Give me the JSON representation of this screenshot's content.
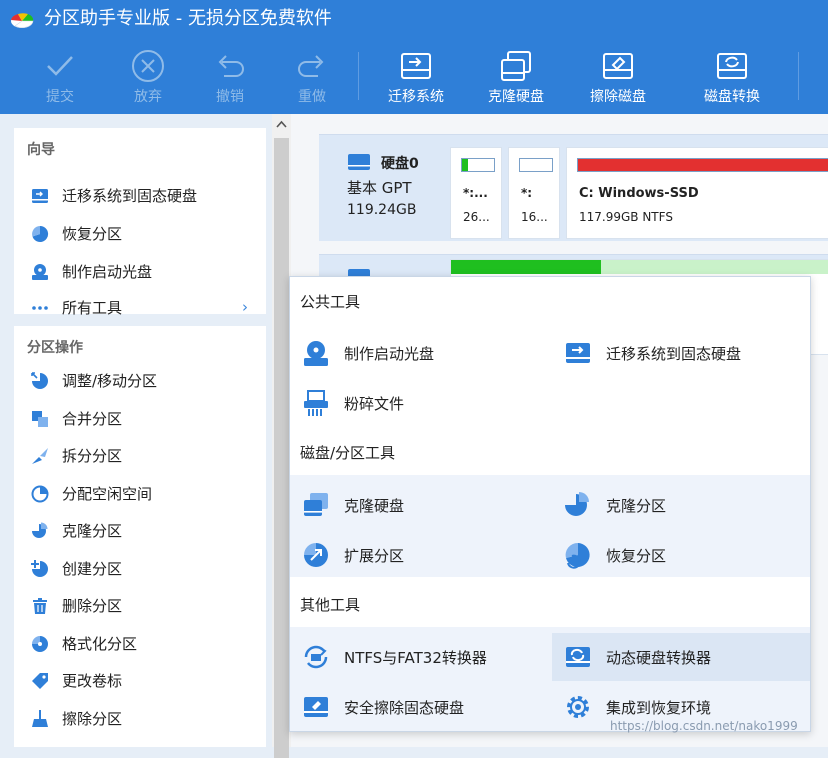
{
  "window": {
    "title": "分区助手专业版 - 无损分区免费软件"
  },
  "toolbar": {
    "submit": "提交",
    "discard": "放弃",
    "undo": "撤销",
    "redo": "重做",
    "migrate": "迁移系统",
    "clone_disk": "克隆硬盘",
    "wipe_disk": "擦除磁盘",
    "convert_disk": "磁盘转换"
  },
  "wizard": {
    "header": "向导",
    "items": [
      "迁移系统到固态硬盘",
      "恢复分区",
      "制作启动光盘",
      "所有工具"
    ]
  },
  "operations": {
    "header": "分区操作",
    "items": [
      "调整/移动分区",
      "合并分区",
      "拆分分区",
      "分配空闲空间",
      "克隆分区",
      "创建分区",
      "删除分区",
      "格式化分区",
      "更改卷标",
      "擦除分区"
    ]
  },
  "disks": [
    {
      "name": "硬盘0",
      "style": "基本 GPT",
      "size": "119.24GB",
      "partitions": [
        {
          "label": "*:...",
          "size": "26...",
          "fill_percent": 20,
          "fill_color": "#1fbf1f"
        },
        {
          "label": "*:",
          "size": "16...",
          "fill_percent": 0,
          "fill_color": "#1fbf1f"
        },
        {
          "label": "C: Windows-SSD",
          "size": "117.99GB NTFS",
          "fill_percent": 100,
          "fill_color": "#e33030"
        }
      ]
    }
  ],
  "popup": {
    "sections": [
      {
        "title": "公共工具",
        "tools": [
          "制作启动光盘",
          "迁移系统到固态硬盘",
          "粉碎文件"
        ]
      },
      {
        "title": "磁盘/分区工具",
        "tools": [
          "克隆硬盘",
          "克隆分区",
          "扩展分区",
          "恢复分区"
        ]
      },
      {
        "title": "其他工具",
        "tools": [
          "NTFS与FAT32转换器",
          "动态硬盘转换器",
          "安全擦除固态硬盘",
          "集成到恢复环境"
        ]
      }
    ]
  },
  "watermark": "https://blog.csdn.net/nako1999",
  "colors": {
    "accent": "#2f7fd8",
    "icon": "#2f7fd8"
  }
}
